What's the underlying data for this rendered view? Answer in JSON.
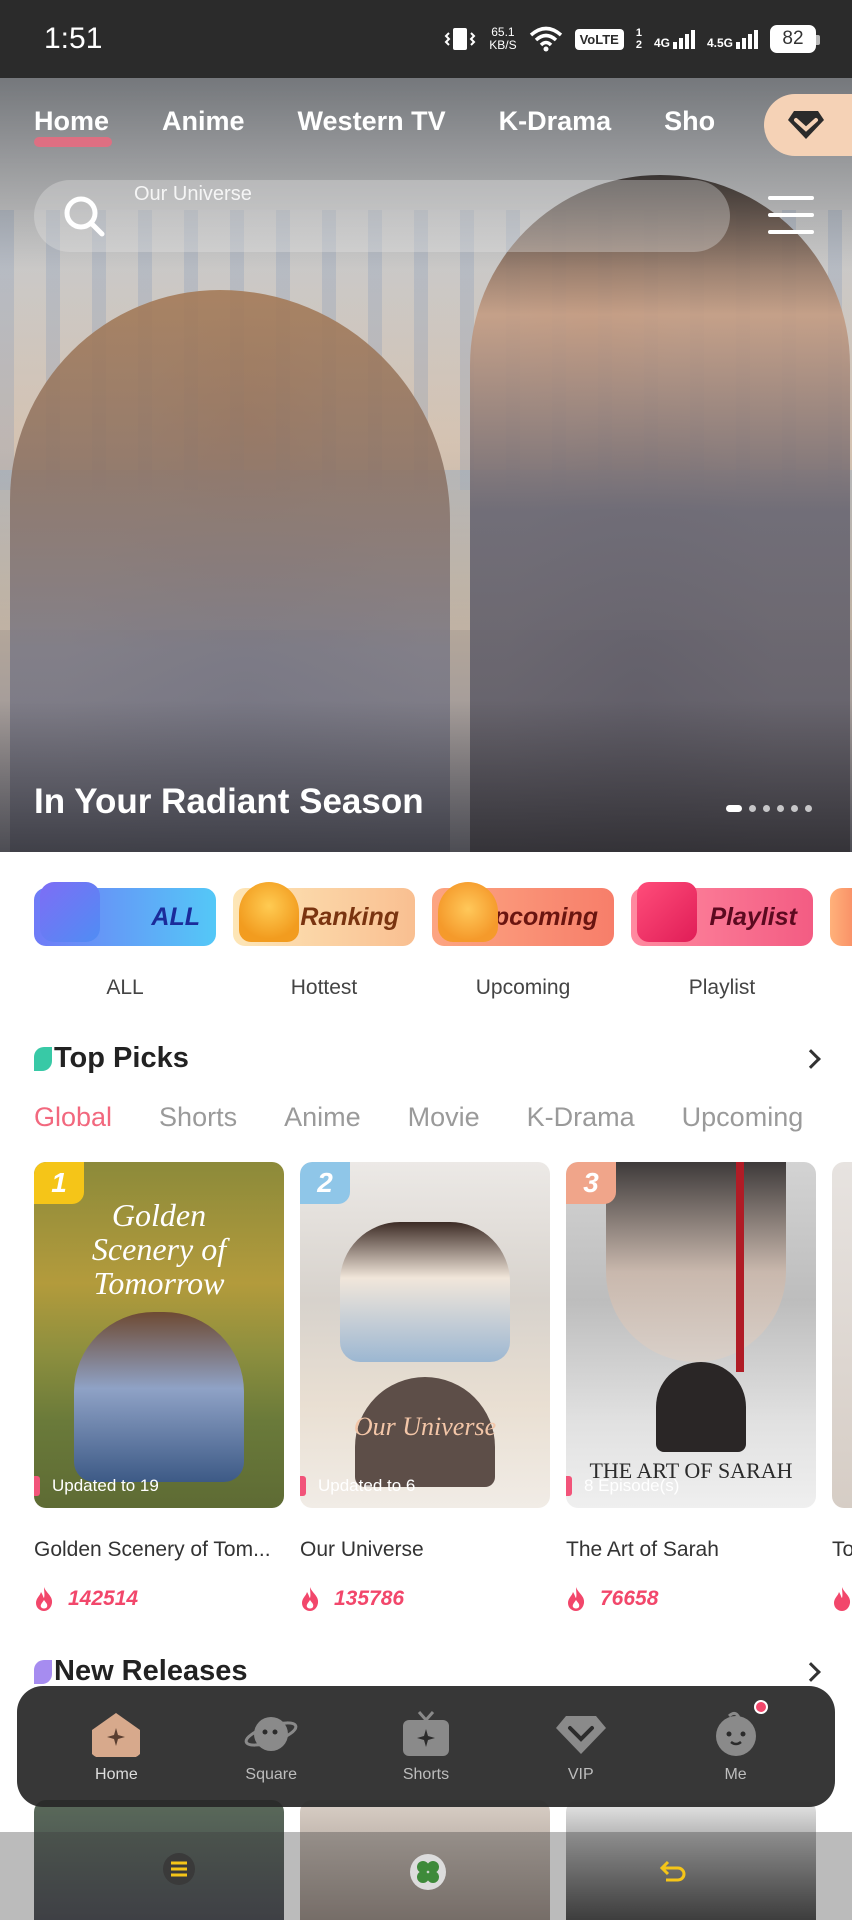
{
  "status_bar": {
    "time": "1:51",
    "speed_value": "65.1",
    "speed_unit": "KB/S",
    "volte": "VoLTE",
    "sim1": "1",
    "sim2": "2",
    "net1": "4G",
    "net2": "4.5G",
    "battery": "82"
  },
  "top_tabs": [
    "Home",
    "Anime",
    "Western TV",
    "K-Drama",
    "Sho"
  ],
  "search": {
    "placeholder": "Our Universe"
  },
  "hero": {
    "title": "In Your Radiant Season",
    "slide_count": 6,
    "active_slide": 1
  },
  "categories": [
    {
      "label": "ALL",
      "caption": "ALL"
    },
    {
      "label": "Ranking",
      "caption": "Hottest"
    },
    {
      "label": "Upcoming",
      "caption": "Upcoming"
    },
    {
      "label": "Playlist",
      "caption": "Playlist"
    }
  ],
  "top_picks": {
    "title": "Top Picks",
    "tabs": [
      "Global",
      "Shorts",
      "Anime",
      "Movie",
      "K-Drama",
      "Upcoming"
    ],
    "active_tab": "Global",
    "items": [
      {
        "rank": "1",
        "rank_color": "#f5c518",
        "poster_text": "Golden Scenery of Tomorrow",
        "note": "Updated to 19",
        "title": "Golden Scenery of Tom...",
        "heat": "142514"
      },
      {
        "rank": "2",
        "rank_color": "#8fc6e8",
        "poster_text": "Our Universe",
        "note": "Updated to 6",
        "title": "Our Universe",
        "heat": "135786"
      },
      {
        "rank": "3",
        "rank_color": "#f0a58a",
        "poster_text": "THE ART OF SARAH",
        "note": "8 Episode(s)",
        "title": "The Art of Sarah",
        "heat": "76658"
      }
    ],
    "partial_title": "To"
  },
  "new_releases": {
    "title": "New Releases"
  },
  "bottom_nav": [
    {
      "label": "Home",
      "icon": "home-icon",
      "active": true
    },
    {
      "label": "Square",
      "icon": "planet-icon",
      "active": false
    },
    {
      "label": "Shorts",
      "icon": "tv-icon",
      "active": false
    },
    {
      "label": "VIP",
      "icon": "diamond-icon",
      "active": false
    },
    {
      "label": "Me",
      "icon": "face-icon",
      "active": false
    }
  ],
  "colors": {
    "accent": "#f2687e",
    "heat": "#f2476b",
    "vip_pill": "#f5d2b6"
  }
}
